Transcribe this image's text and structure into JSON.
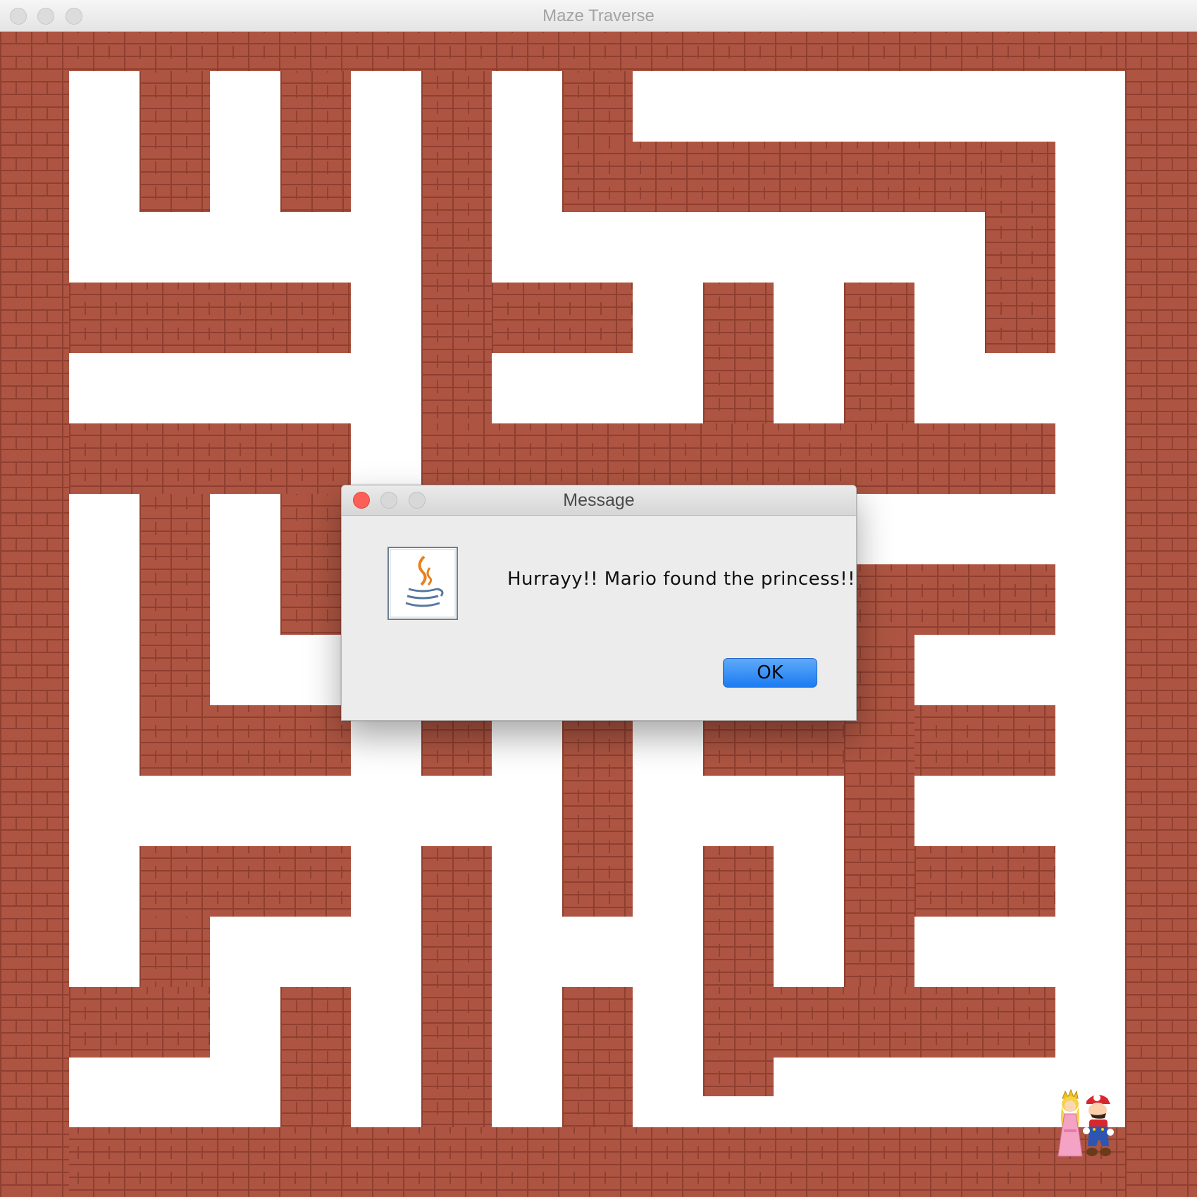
{
  "window": {
    "title": "Maze Traverse"
  },
  "maze": {
    "player": "Mario",
    "goal": "princess"
  },
  "dialog": {
    "title": "Message",
    "message": "Hurrayy!! Mario found the princess!!",
    "ok_label": "OK",
    "icon": "java-icon"
  }
}
